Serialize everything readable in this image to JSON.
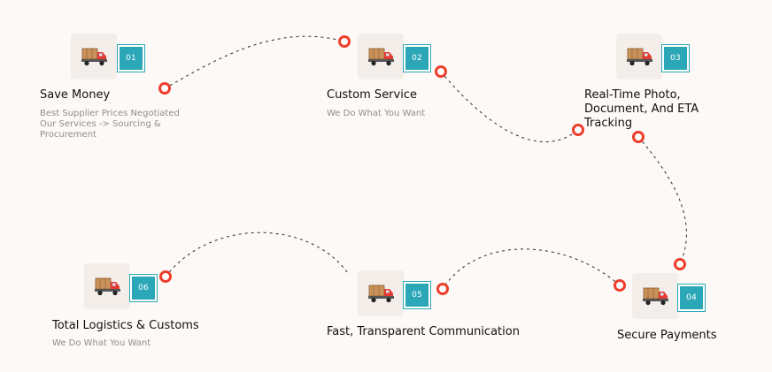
{
  "colors": {
    "background": "#fcf9f7",
    "accent_teal": "#2ba7b7",
    "dot_red": "#ef3d2b",
    "icon_bg": "#f3eeea"
  },
  "steps": [
    {
      "number": "01",
      "icon": "delivery-truck-icon",
      "title": "Save Money",
      "description_lines": [
        "Best Supplier Prices Negotiated",
        "Our Services -> Sourcing &",
        "Procurement"
      ]
    },
    {
      "number": "02",
      "icon": "delivery-truck-icon",
      "title": "Custom Service",
      "description_lines": [
        "We Do What You Want"
      ]
    },
    {
      "number": "03",
      "icon": "delivery-truck-icon",
      "title_lines": [
        "Real-Time Photo,",
        "Document, And ETA",
        "Tracking"
      ]
    },
    {
      "number": "04",
      "icon": "delivery-truck-icon",
      "title": "Secure Payments"
    },
    {
      "number": "05",
      "icon": "delivery-truck-icon",
      "title": "Fast, Transparent Communication"
    },
    {
      "number": "06",
      "icon": "delivery-truck-icon",
      "title": "Total Logistics & Customs",
      "description_lines": [
        "We Do What You Want"
      ]
    }
  ]
}
